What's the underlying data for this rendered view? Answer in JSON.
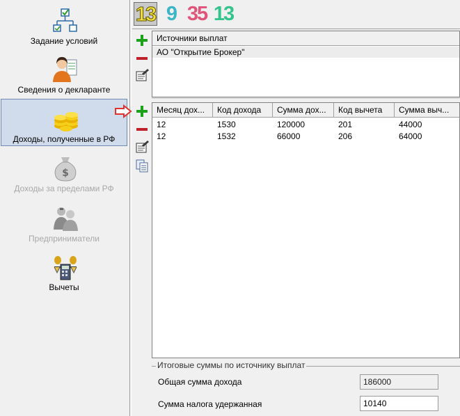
{
  "sidebar": {
    "items": [
      {
        "label": "Задание условий"
      },
      {
        "label": "Сведения о декларанте"
      },
      {
        "label": "Доходы, полученные в РФ"
      },
      {
        "label": "Доходы за пределами РФ"
      },
      {
        "label": "Предприниматели"
      },
      {
        "label": "Вычеты"
      }
    ]
  },
  "toolbar": {
    "years": [
      {
        "label": "13",
        "color": "#f4e23a"
      },
      {
        "label": "9",
        "color": "#3cb5c6"
      },
      {
        "label": "35",
        "color": "#e0567a"
      },
      {
        "label": "13",
        "color": "#34c38c"
      }
    ]
  },
  "sources": {
    "header": "Источники выплат",
    "rows": [
      "АО \"Открытие Брокер\""
    ]
  },
  "income": {
    "headers": [
      "Месяц дох...",
      "Код дохода",
      "Сумма дох...",
      "Код вычета",
      "Сумма выч..."
    ],
    "rows": [
      [
        "12",
        "1530",
        "120000",
        "201",
        "44000"
      ],
      [
        "12",
        "1532",
        "66000",
        "206",
        "64000"
      ]
    ]
  },
  "totals": {
    "title": "Итоговые суммы по источнику выплат",
    "income_label": "Общая сумма дохода",
    "income_value": "186000",
    "tax_label": "Сумма налога удержанная",
    "tax_value": "10140"
  },
  "colors": {
    "add": "#1aa21a",
    "remove": "#c0202a",
    "pointer_arrow": "#e03030",
    "selection": "#d0dceb"
  }
}
